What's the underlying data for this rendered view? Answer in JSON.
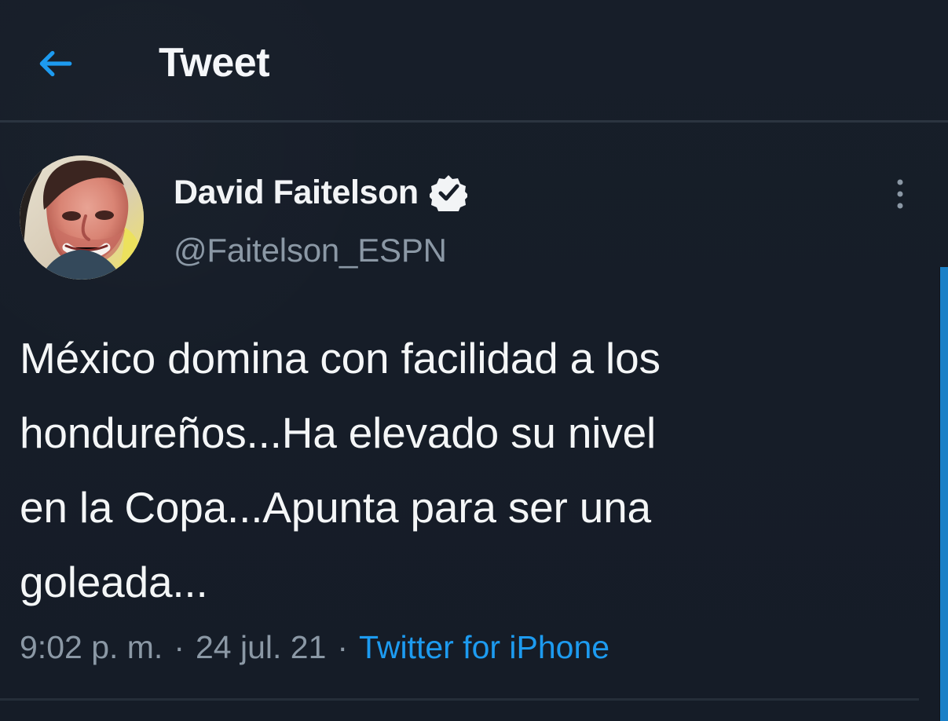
{
  "header": {
    "back_icon": "arrow-left-icon",
    "title": "Tweet"
  },
  "tweet": {
    "author": {
      "display_name": "David Faitelson",
      "handle": "@Faitelson_ESPN",
      "verified_icon": "verified-check-icon",
      "avatar_icon": "avatar-photo"
    },
    "more_icon": "vertical-ellipsis-icon",
    "text_lines": [
      "México domina con facilidad a los",
      "hondureños...Ha elevado su nivel",
      "en la Copa...Apunta para ser una",
      "goleada..."
    ],
    "metadata": {
      "time": "9:02 p. m.",
      "separator_1": "·",
      "date": "24 jul. 21",
      "separator_2": "·",
      "source": "Twitter for iPhone"
    }
  },
  "colors": {
    "background": "#161d28",
    "primary_text": "#f2f4f6",
    "secondary_text": "#8b98a5",
    "accent": "#1d9bf0",
    "divider": "#2b3440"
  }
}
